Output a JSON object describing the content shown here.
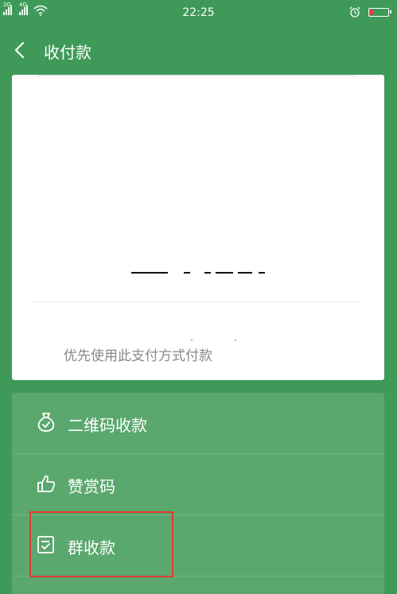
{
  "status_bar": {
    "sim1_tag": "2G",
    "sim2_tag": "4G",
    "time": "22:25",
    "icons": [
      "signal-icon",
      "signal-icon",
      "wifi-icon",
      "alarm-icon",
      "battery-icon"
    ],
    "battery_level": 0.18,
    "battery_color": "#e8413d"
  },
  "header": {
    "title": "收付款",
    "back_icon": "chevron-left-icon"
  },
  "card": {
    "pay_method_note": "优先使用此支付方式付款"
  },
  "menu": {
    "items": [
      {
        "label": "二维码收款",
        "icon": "money-bag-icon"
      },
      {
        "label": "赞赏码",
        "icon": "thumbs-up-icon"
      },
      {
        "label": "群收款",
        "icon": "group-receipt-icon"
      }
    ]
  },
  "colors": {
    "background": "#3f9a59",
    "menu_panel": "#5aa86e",
    "highlight": "#e33a2f"
  }
}
